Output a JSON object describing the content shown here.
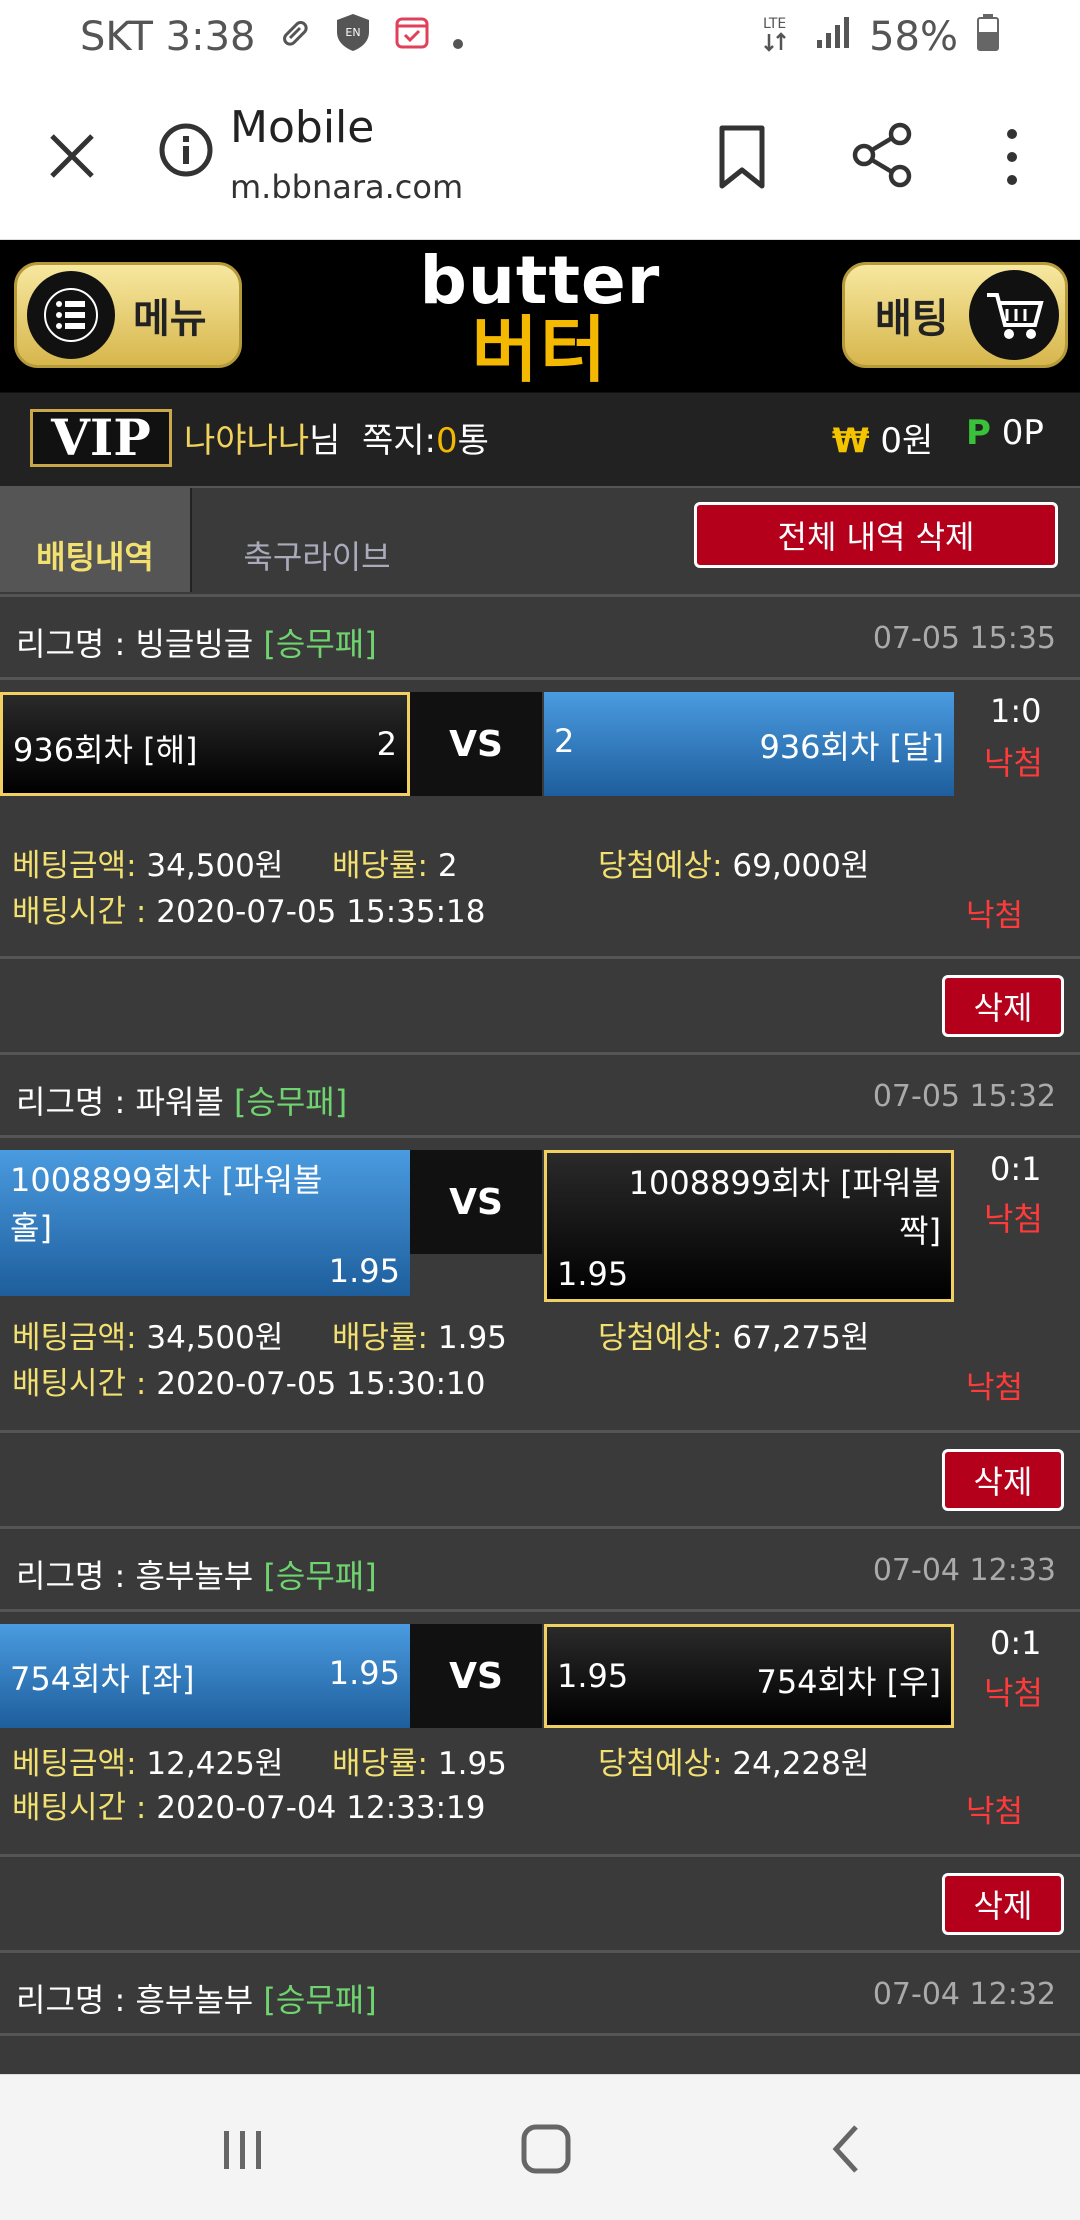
{
  "status": {
    "carrier_time": "SKT 3:38",
    "network": "LTE",
    "battery": "58%"
  },
  "browser": {
    "title": "Mobile",
    "url": "m.bbnara.com"
  },
  "header": {
    "menu_label": "메뉴",
    "bet_label": "배팅",
    "logo_en": "butter",
    "logo_ko": "버터"
  },
  "user": {
    "vip": "VIP",
    "name": "나야나나",
    "name_suffix": "님",
    "msg_label": "쪽지:",
    "msg_count": "0",
    "msg_unit": "통",
    "won_symbol": "₩",
    "won_value": "0원",
    "point_symbol": "P",
    "point_value": "0P"
  },
  "tabs": {
    "active": "배팅내역",
    "live": "축구라이브",
    "delete_all": "전체 내역 삭제"
  },
  "entries": [
    {
      "league_label": "리그명 : 빙글빙글",
      "league_tag": "[승무패]",
      "time": "07-05 15:35",
      "home_name": "936회차 [해]",
      "home_odds": "2",
      "away_name": "936회차 [달]",
      "away_odds": "2",
      "vs": "VS",
      "score": "1:0",
      "result": "낙첨",
      "amount_label": "베팅금액:",
      "amount": "34,500원",
      "rate_label": "배당률:",
      "rate": "2",
      "expect_label": "당첨예상:",
      "expect": "69,000원",
      "bettime_label": "배팅시간 :",
      "bettime": "2020-07-05 15:35:18",
      "status": "낙첨",
      "delete": "삭제"
    },
    {
      "league_label": "리그명 : 파워볼",
      "league_tag": "[승무패]",
      "time": "07-05 15:32",
      "home_name": "1008899회차 [파워볼 홀]",
      "home_odds": "1.95",
      "away_name": "1008899회차 [파워볼 짝]",
      "away_odds": "1.95",
      "vs": "VS",
      "score": "0:1",
      "result": "낙첨",
      "amount_label": "베팅금액:",
      "amount": "34,500원",
      "rate_label": "배당률:",
      "rate": "1.95",
      "expect_label": "당첨예상:",
      "expect": "67,275원",
      "bettime_label": "배팅시간 :",
      "bettime": "2020-07-05 15:30:10",
      "status": "낙첨",
      "delete": "삭제"
    },
    {
      "league_label": "리그명 : 흥부놀부",
      "league_tag": "[승무패]",
      "time": "07-04 12:33",
      "home_name": "754회차 [좌]",
      "home_odds": "1.95",
      "away_name": "754회차 [우]",
      "away_odds": "1.95",
      "vs": "VS",
      "score": "0:1",
      "result": "낙첨",
      "amount_label": "베팅금액:",
      "amount": "12,425원",
      "rate_label": "배당률:",
      "rate": "1.95",
      "expect_label": "당첨예상:",
      "expect": "24,228원",
      "bettime_label": "배팅시간 :",
      "bettime": "2020-07-04 12:33:19",
      "status": "낙첨",
      "delete": "삭제"
    },
    {
      "league_label": "리그명 : 흥부놀부",
      "league_tag": "[승무패]",
      "time": "07-04 12:32"
    }
  ],
  "colors": {
    "accent_gold": "#f2e070",
    "danger_red": "#b5001b",
    "blue_team": "#2f7bc4",
    "background": "#3a3a3a"
  },
  "icons": {
    "close": "close-icon",
    "info": "info-icon",
    "bookmark": "bookmark-icon",
    "share": "share-icon",
    "more": "more-vert-icon",
    "menu": "hamburger-icon",
    "cart": "cart-icon"
  }
}
